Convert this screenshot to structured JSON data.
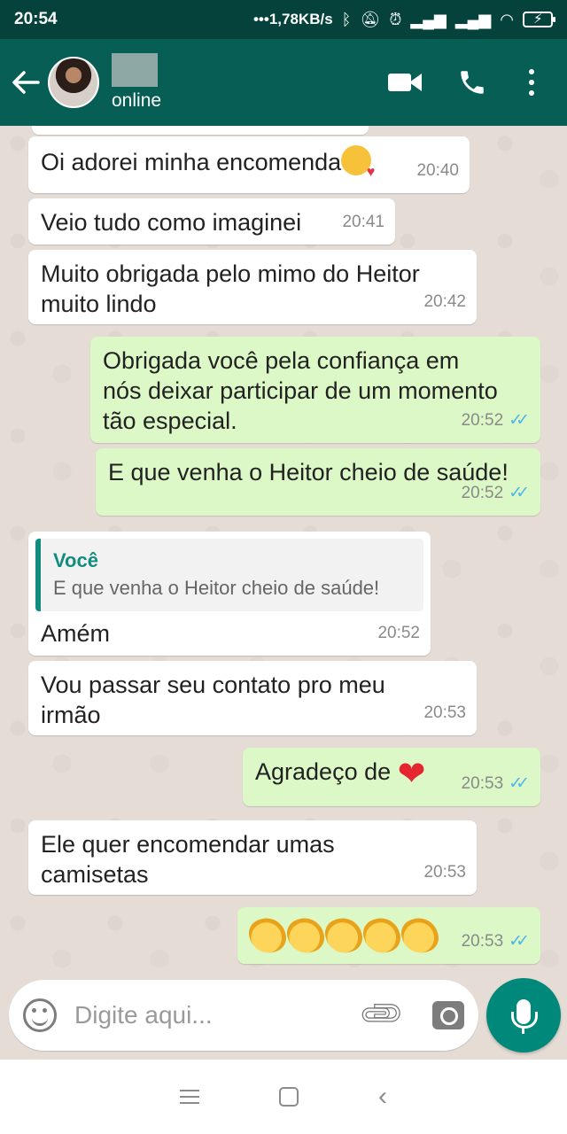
{
  "status_bar": {
    "time": "20:54",
    "network_speed": "1,78KB/s",
    "icons": [
      "bluetooth-icon",
      "mute-icon",
      "alarm-icon",
      "signal-icon",
      "signal-icon",
      "wifi-icon",
      "battery-charging-icon"
    ]
  },
  "header": {
    "presence": "online",
    "icons": [
      "back-arrow-icon",
      "video-call-icon",
      "phone-call-icon",
      "more-options-icon"
    ]
  },
  "messages": [
    {
      "direction": "in",
      "text": "Oi adorei minha encomenda",
      "emoji": "kiss-emoji",
      "time": "20:40"
    },
    {
      "direction": "in",
      "text": "Veio tudo como imaginei",
      "time": "20:41"
    },
    {
      "direction": "in",
      "text_lines": [
        "Muito obrigada pelo mimo do Heitor",
        "muito lindo"
      ],
      "time": "20:42"
    },
    {
      "direction": "out",
      "text_lines": [
        "Obrigada você pela confiança em",
        "nós deixar participar de um momento",
        "tão especial."
      ],
      "time": "20:52",
      "read": true
    },
    {
      "direction": "out",
      "text": "E que venha o Heitor cheio de saúde!",
      "time": "20:52",
      "read": true
    },
    {
      "direction": "in",
      "quote": {
        "author": "Você",
        "text": "E que venha o Heitor cheio de saúde!"
      },
      "text": "Amém",
      "time": "20:52"
    },
    {
      "direction": "in",
      "text_lines": [
        "Vou passar seu contato pro meu",
        "irmão"
      ],
      "time": "20:53"
    },
    {
      "direction": "out",
      "text": "Agradeço de",
      "emoji": "red-heart-emoji",
      "time": "20:53",
      "read": true
    },
    {
      "direction": "in",
      "text_lines": [
        "Ele quer encomendar umas",
        "camisetas"
      ],
      "time": "20:53"
    },
    {
      "direction": "out",
      "emoji": "clapping-hands-emoji",
      "emoji_count": 5,
      "time": "20:53",
      "read": true
    }
  ],
  "composer": {
    "placeholder": "Digite aqui...",
    "icons": [
      "emoji-icon",
      "attach-icon",
      "camera-icon",
      "mic-icon"
    ]
  },
  "colors": {
    "header": "#075e54",
    "status_bar": "#04423b",
    "chat_background": "#e5ddd5",
    "incoming_bubble": "#ffffff",
    "outgoing_bubble": "#dcf8c6",
    "read_ticks": "#4fb6ec",
    "quote_accent": "#128c7e",
    "mic_button": "#00897b"
  }
}
